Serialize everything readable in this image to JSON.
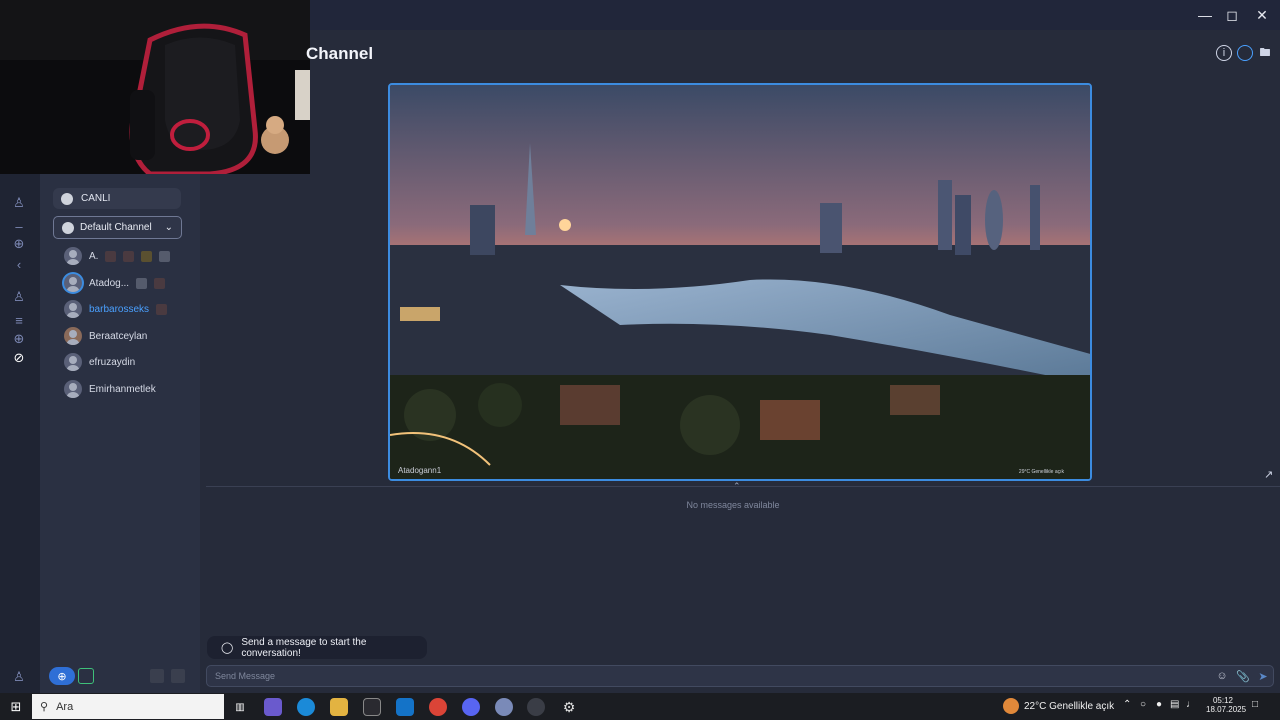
{
  "window": {
    "minimize_icon": "minimize-icon",
    "maximize_icon": "maximize-icon",
    "close_icon": "close-icon"
  },
  "header": {
    "title": "Channel",
    "info_icon": "info-icon",
    "chat_icon": "chat-bubble-icon",
    "folder_icon": "folder-icon"
  },
  "sidebar": {
    "live_label": "CANLI",
    "channel_select": "Default Channel",
    "users": [
      {
        "name": "A.",
        "highlight": false
      },
      {
        "name": "Atadog...",
        "highlight": false
      },
      {
        "name": "barbarosseks",
        "highlight": true
      },
      {
        "name": "Beraatceylan",
        "highlight": false
      },
      {
        "name": "efruzaydin",
        "highlight": false
      },
      {
        "name": "Emirhanmetlek",
        "highlight": false
      }
    ]
  },
  "stream": {
    "owner_label": "Atadogann1",
    "weather_text": "29°C Genellikle açık"
  },
  "messages": {
    "empty_text": "No messages available",
    "toast": "Send a message to start the conversation!",
    "placeholder": "Send Message"
  },
  "taskbar": {
    "search_text": "Ara",
    "weather": "22°C  Genellikle açık",
    "time": "05:12",
    "date": "18.07.2025"
  },
  "colors": {
    "accent": "#3c8ce0",
    "background": "#262b3a",
    "highlight_user": "#4aa0ff"
  }
}
